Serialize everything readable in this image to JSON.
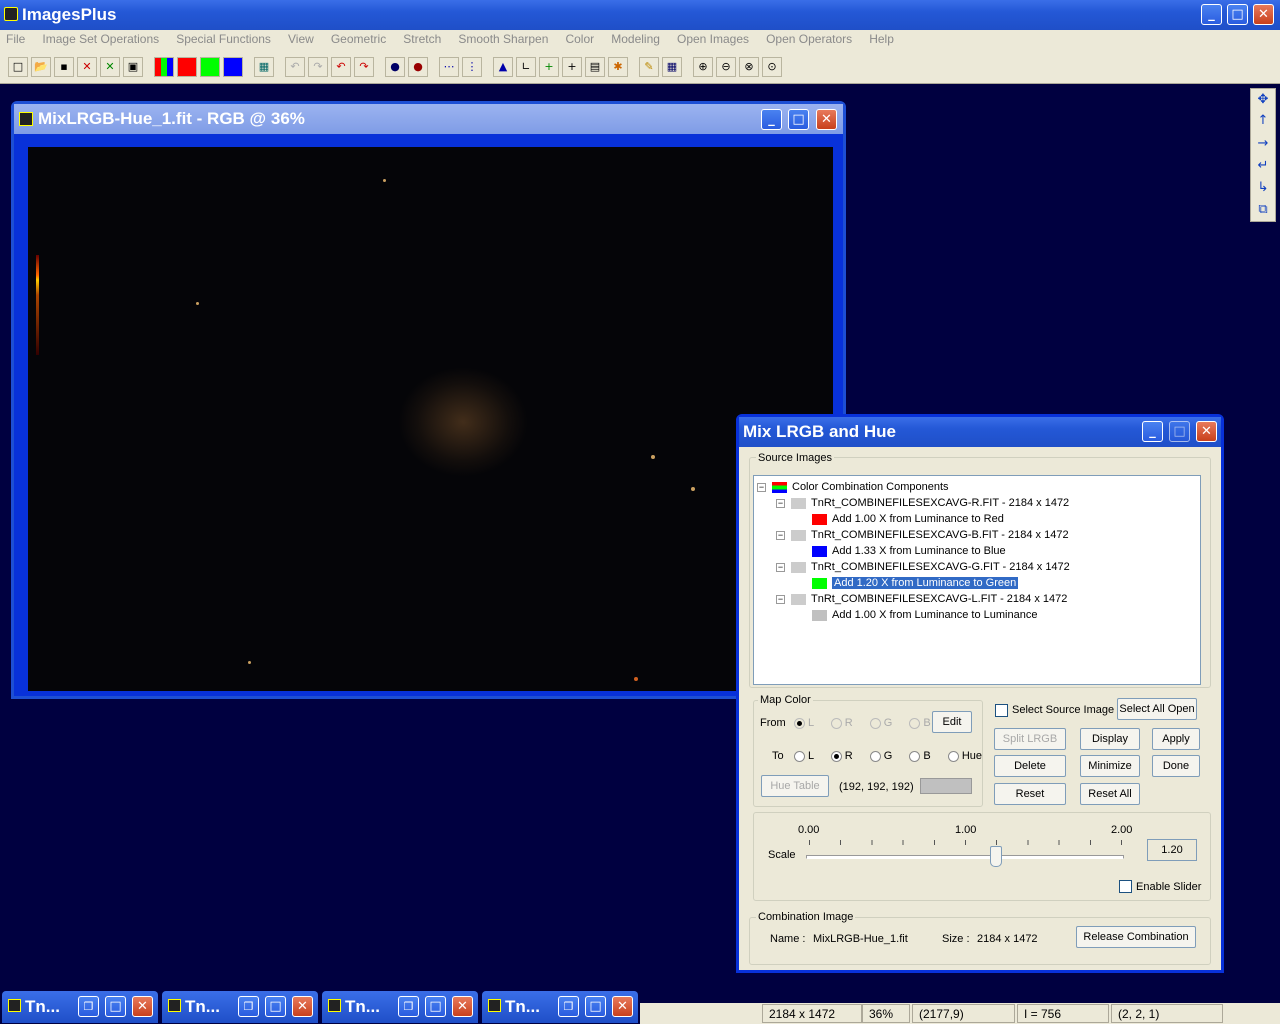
{
  "app": {
    "title": "ImagesPlus"
  },
  "menu": [
    "File",
    "Image Set Operations",
    "Special Functions",
    "View",
    "Geometric",
    "Stretch",
    "Smooth Sharpen",
    "Color",
    "Modeling",
    "Open Images",
    "Open Operators",
    "Help"
  ],
  "image_window": {
    "title": "MixLRGB-Hue_1.fit - RGB @ 36%"
  },
  "dialog": {
    "title": "Mix LRGB and Hue",
    "source_label": "Source Images",
    "tree": {
      "root": "Color Combination Components",
      "items": [
        {
          "file": "TnRt_COMBINEFILESEXCAVG-R.FIT - 2184 x 1472",
          "child": "Add 1.00 X from Luminance to Red",
          "color": "#ff0000"
        },
        {
          "file": "TnRt_COMBINEFILESEXCAVG-B.FIT - 2184 x 1472",
          "child": "Add 1.33 X from Luminance to Blue",
          "color": "#0000ff"
        },
        {
          "file": "TnRt_COMBINEFILESEXCAVG-G.FIT - 2184 x 1472",
          "child": "Add 1.20 X from Luminance to Green",
          "color": "#00ff00"
        },
        {
          "file": "TnRt_COMBINEFILESEXCAVG-L.FIT - 2184 x 1472",
          "child": "Add 1.00 X from Luminance to Luminance",
          "color": "#c0c0c0"
        }
      ]
    },
    "map_color": {
      "label": "Map Color",
      "from_label": "From",
      "to_label": "To",
      "radios": {
        "L": "L",
        "R": "R",
        "G": "G",
        "B": "B",
        "Hue": "Hue"
      },
      "edit": "Edit",
      "hue_table": "Hue Table",
      "rgb_value": "(192, 192, 192)",
      "swatch_color": "#c0c0c0"
    },
    "select_source": "Select Source Image",
    "buttons": {
      "select_all_open": "Select All Open",
      "split_lrgb": "Split LRGB",
      "display": "Display",
      "apply": "Apply",
      "delete": "Delete",
      "minimize": "Minimize",
      "done": "Done",
      "reset": "Reset",
      "reset_all": "Reset All"
    },
    "scale": {
      "label": "Scale",
      "min": "0.00",
      "mid": "1.00",
      "max": "2.00",
      "value": "1.20",
      "slider_fraction": 0.6
    },
    "enable_slider": "Enable Slider",
    "combination": {
      "label": "Combination Image",
      "name_label": "Name :",
      "name": "MixLRGB-Hue_1.fit",
      "size_label": "Size :",
      "size": "2184 x 1472",
      "release": "Release Combination"
    }
  },
  "taskbar": [
    {
      "label": "Tn..."
    },
    {
      "label": "Tn..."
    },
    {
      "label": "Tn..."
    },
    {
      "label": "Tn..."
    }
  ],
  "status": {
    "dims": "2184 x 1472",
    "zoom": "36%",
    "coords": "(2177,9)",
    "intensity": "I = 756",
    "rgb": "(2, 2, 1)"
  }
}
